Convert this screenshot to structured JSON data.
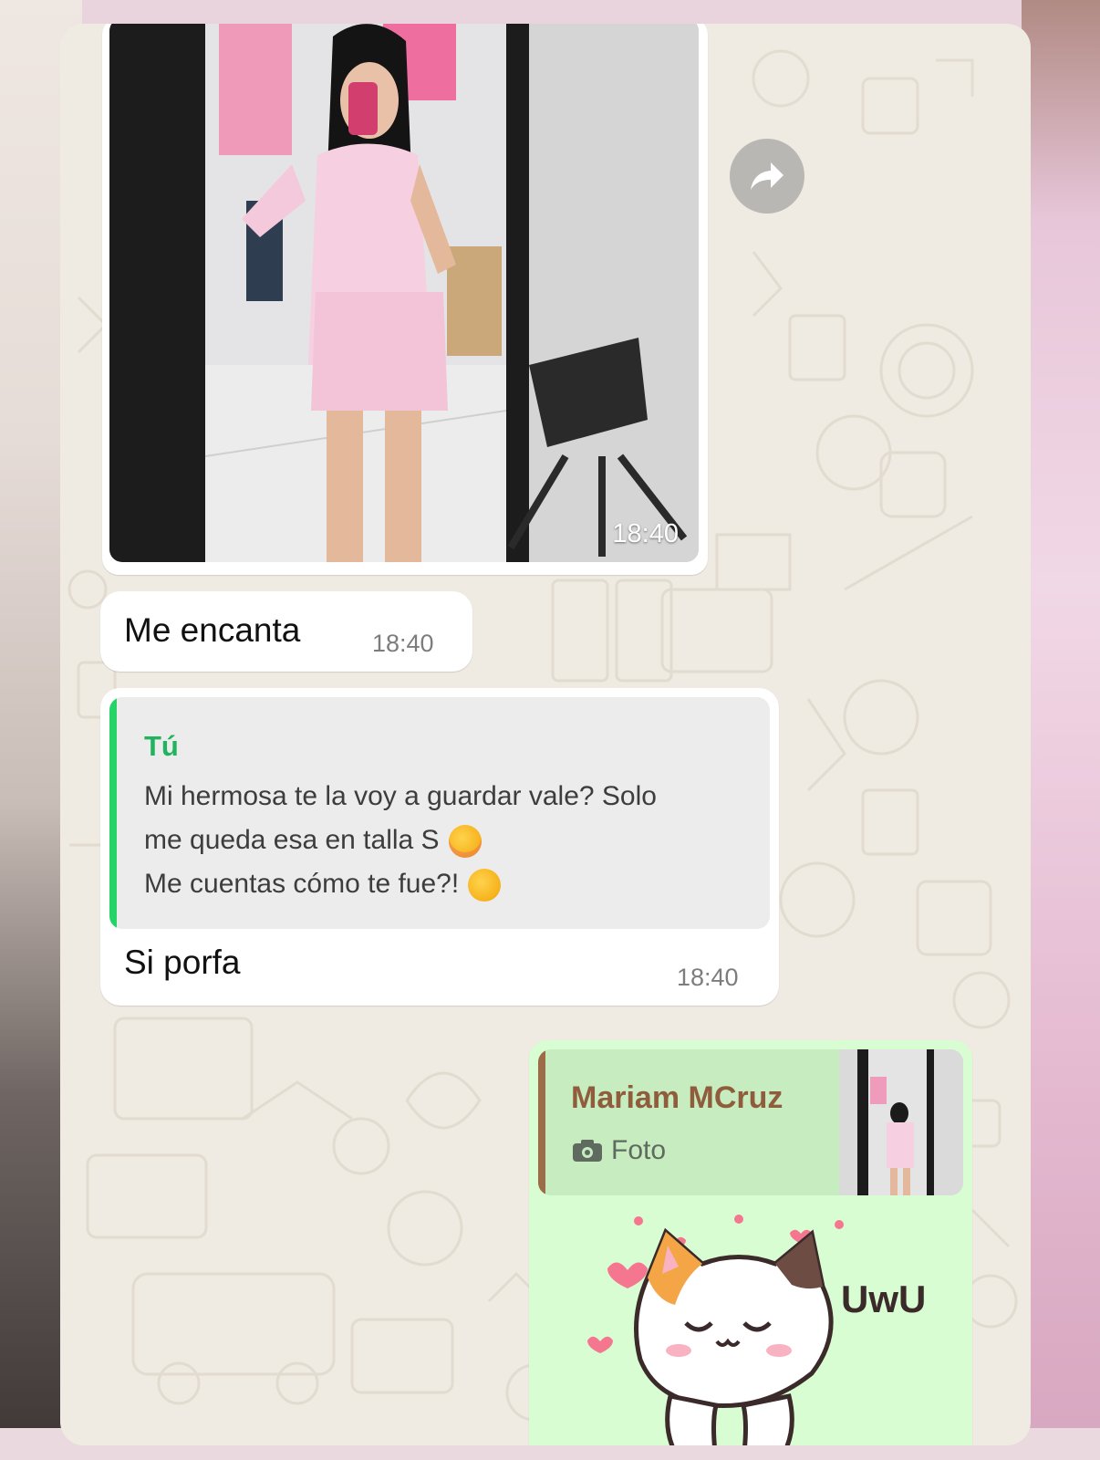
{
  "image_message": {
    "timestamp": "18:40"
  },
  "messages": [
    {
      "text": "Me encanta",
      "time": "18:40"
    },
    {
      "quoted": {
        "author": "Tú",
        "lines": [
          "Mi hermosa te la voy a guardar vale? Solo",
          "me queda esa en talla S",
          "Me cuentas cómo te fue?!"
        ]
      },
      "text": "Si porfa",
      "time": "18:40"
    }
  ],
  "outgoing": {
    "reply_author": "Mariam MCruz",
    "reply_type": "Foto",
    "sticker_text": "UwU"
  },
  "icons": {
    "forward": "forward-arrow-icon",
    "camera": "camera-icon"
  },
  "colors": {
    "chat_background": "#efeae2",
    "incoming_bubble": "#ffffff",
    "outgoing_bubble": "#d9fdd3",
    "quote_bar_green": "#25d366",
    "quote_author_green": "#21b35d",
    "reply_author_brown": "#8f5d3c"
  }
}
